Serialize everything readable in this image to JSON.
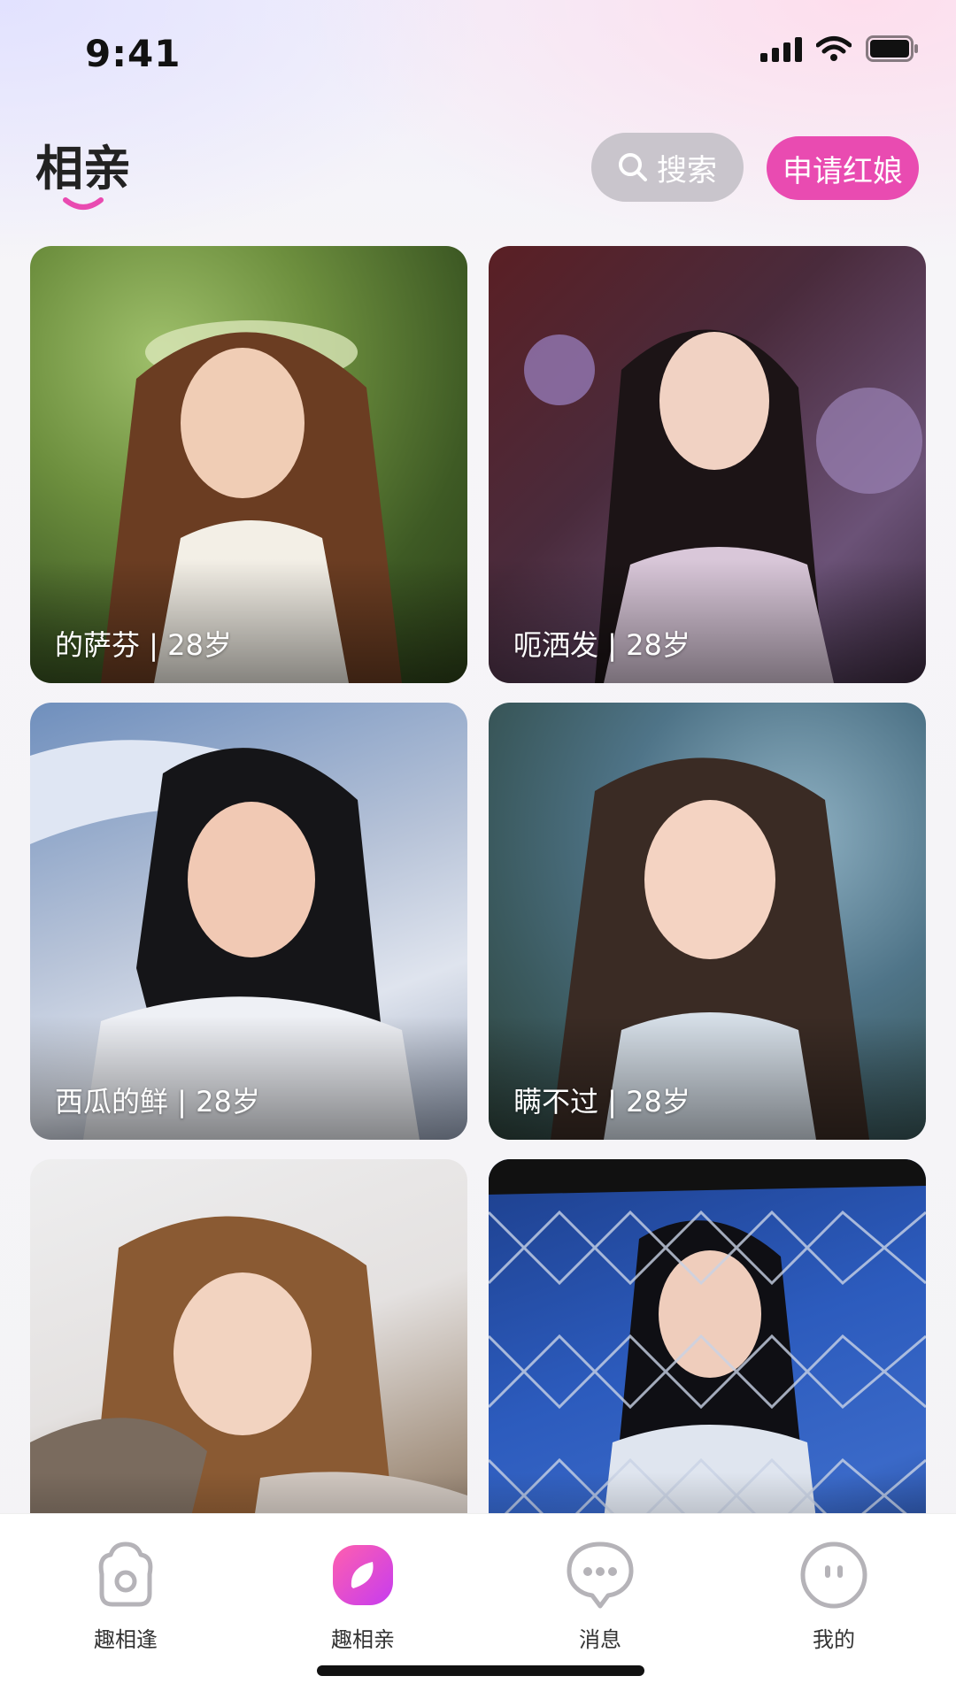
{
  "status_bar": {
    "time": "9:41",
    "icons": [
      "signal-icon",
      "wifi-icon",
      "battery-icon"
    ]
  },
  "header": {
    "title": "相亲",
    "search_label": "搜索",
    "matchmaker_label": "申请红娘",
    "accent_color": "#e94bb1"
  },
  "cards": [
    {
      "label": "的萨芬 | 28岁"
    },
    {
      "label": "呃洒发 | 28岁"
    },
    {
      "label": "西瓜的鲜 | 28岁"
    },
    {
      "label": "瞒不过 | 28岁"
    },
    {
      "label": ""
    },
    {
      "label": ""
    }
  ],
  "tabs": [
    {
      "label": "趣相逢",
      "icon": "home-icon",
      "active": false
    },
    {
      "label": "趣相亲",
      "icon": "heart-badge-icon",
      "active": true
    },
    {
      "label": "消息",
      "icon": "message-icon",
      "active": false
    },
    {
      "label": "我的",
      "icon": "profile-icon",
      "active": false
    }
  ]
}
